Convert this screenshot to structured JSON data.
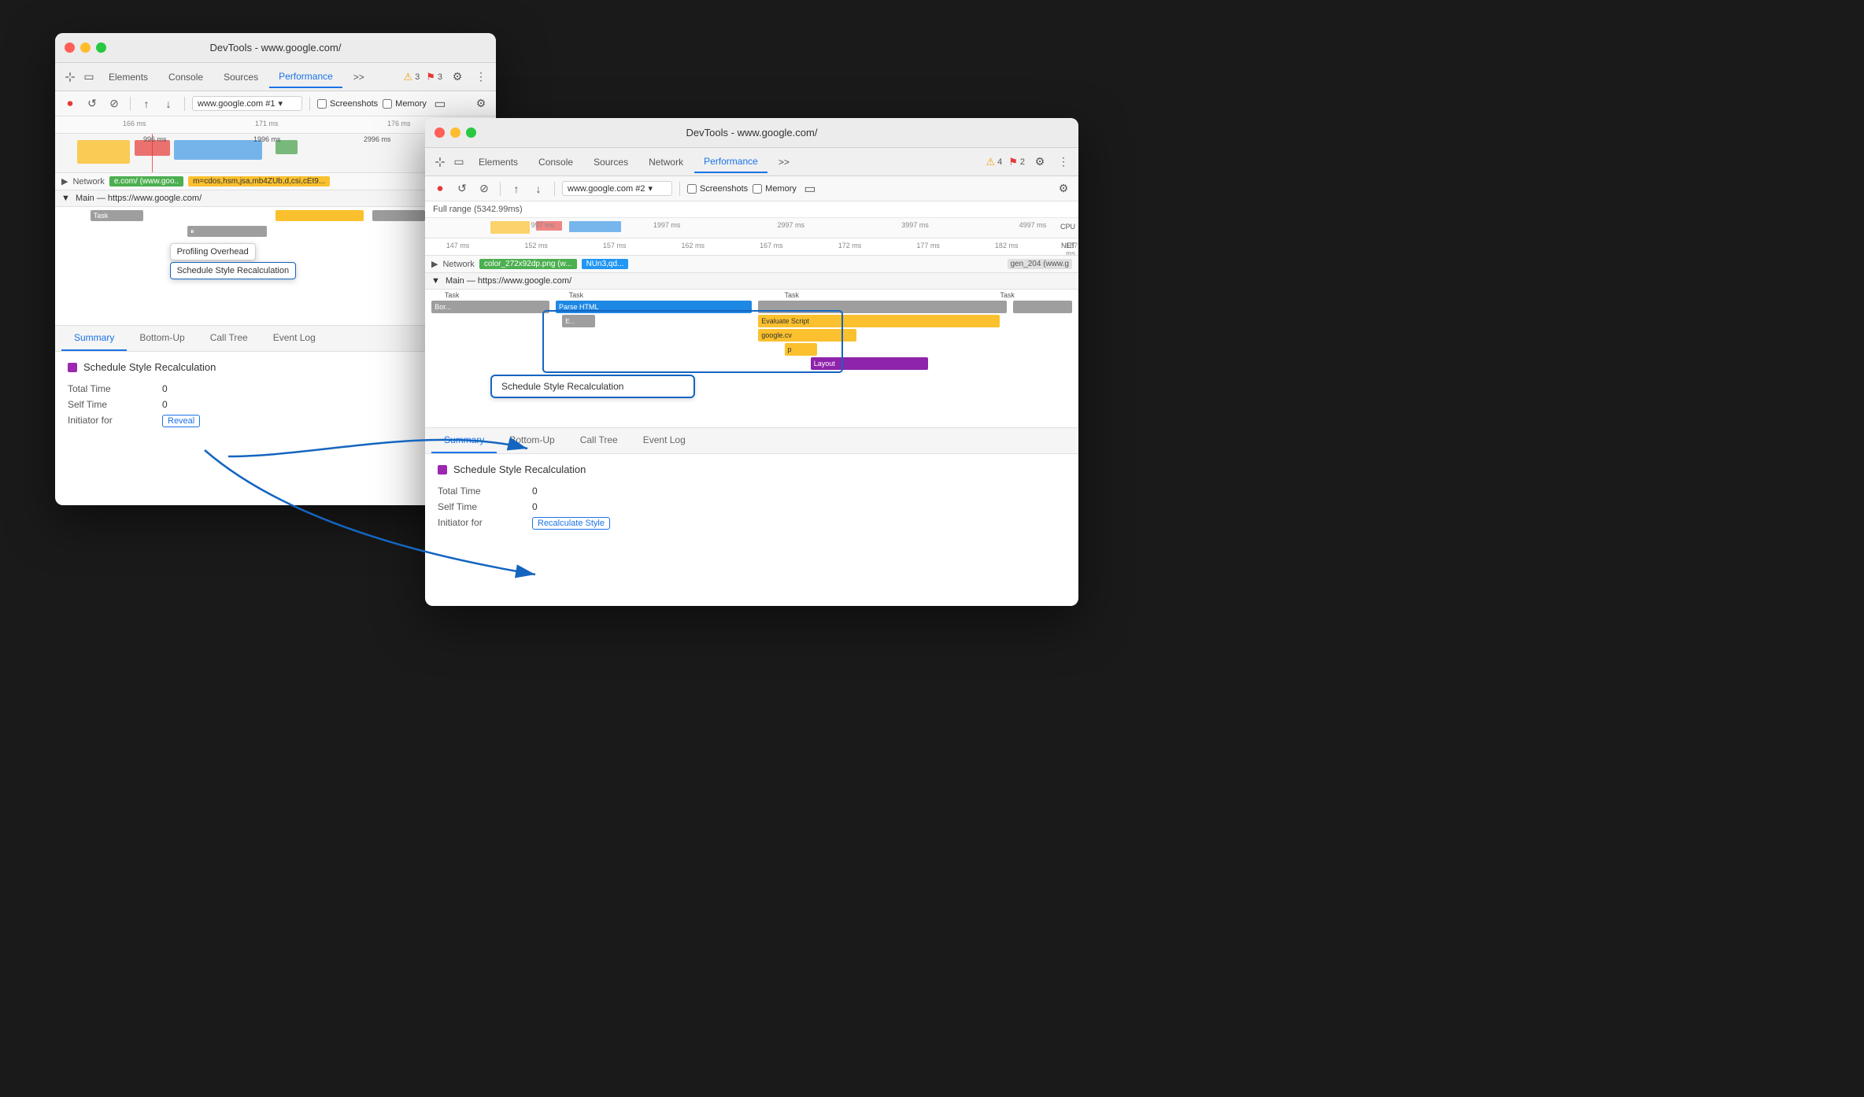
{
  "window1": {
    "title": "DevTools - www.google.com/",
    "tabs": [
      "Elements",
      "Console",
      "Sources",
      "Performance",
      ">>"
    ],
    "active_tab": "Performance",
    "warnings": "3",
    "errors": "3",
    "toolbar": {
      "url": "www.google.com #1",
      "screenshots_label": "Screenshots",
      "memory_label": "Memory"
    },
    "ruler_marks": [
      "166 ms",
      "171 ms",
      "176 ms"
    ],
    "network_row": {
      "label": "Network",
      "items": [
        "e.com/ (www.goo..",
        "m=cdos,hsm,jsa,mb4ZUb,d,csi,cEt9..."
      ]
    },
    "main_thread": "Main — https://www.google.com/",
    "tooltip_text": "Profiling Overhead",
    "tooltip2_text": "Schedule Style Recalculation",
    "bottom_tabs": [
      "Summary",
      "Bottom-Up",
      "Call Tree",
      "Event Log"
    ],
    "active_bottom_tab": "Summary",
    "summary": {
      "title": "Schedule Style Recalculation",
      "color": "#9c27b0",
      "rows": [
        {
          "key": "Total Time",
          "val": "0"
        },
        {
          "key": "Self Time",
          "val": "0"
        },
        {
          "key": "Initiator for",
          "link": "Reveal"
        }
      ]
    }
  },
  "window2": {
    "title": "DevTools - www.google.com/",
    "tabs": [
      "Elements",
      "Console",
      "Sources",
      "Network",
      "Performance",
      ">>"
    ],
    "active_tab": "Performance",
    "warnings": "4",
    "errors": "2",
    "toolbar": {
      "url": "www.google.com #2",
      "screenshots_label": "Screenshots",
      "memory_label": "Memory"
    },
    "range_label": "Full range (5342.99ms)",
    "ruler_marks": [
      "997 ms",
      "1997 ms",
      "2997 ms",
      "3997 ms",
      "4997 ms"
    ],
    "mini_ruler_marks": [
      "147 ms",
      "152 ms",
      "157 ms",
      "162 ms",
      "167 ms",
      "172 ms",
      "177 ms",
      "182 ms",
      "187 ms"
    ],
    "network_row": {
      "label": "Network",
      "items": [
        "color_272x92dp.png (w...",
        "NUn3,qd...",
        "gen_204 (www.g"
      ]
    },
    "main_thread": "Main — https://www.google.com/",
    "task_labels": [
      "Task",
      "Task",
      "Task",
      "Task"
    ],
    "task_items": [
      "Bor...",
      "Parse HTML",
      "E...",
      "Evaluate Script",
      "google.cv",
      "p",
      "Layout"
    ],
    "callout_text": "Schedule Style Recalculation",
    "bottom_tabs": [
      "Summary",
      "Bottom-Up",
      "Call Tree",
      "Event Log"
    ],
    "active_bottom_tab": "Summary",
    "summary": {
      "title": "Schedule Style Recalculation",
      "color": "#9c27b0",
      "rows": [
        {
          "key": "Total Time",
          "val": "0"
        },
        {
          "key": "Self Time",
          "val": "0"
        },
        {
          "key": "Initiator for",
          "link": "Recalculate Style"
        }
      ]
    }
  },
  "icons": {
    "record": "⏺",
    "reload": "↺",
    "clear": "⊘",
    "upload": "↑",
    "download": "↓",
    "settings": "⚙",
    "more": "⋮",
    "chevron": "▾",
    "warning": "⚠",
    "error": "✖",
    "play": "▶",
    "pause": "⏸"
  }
}
